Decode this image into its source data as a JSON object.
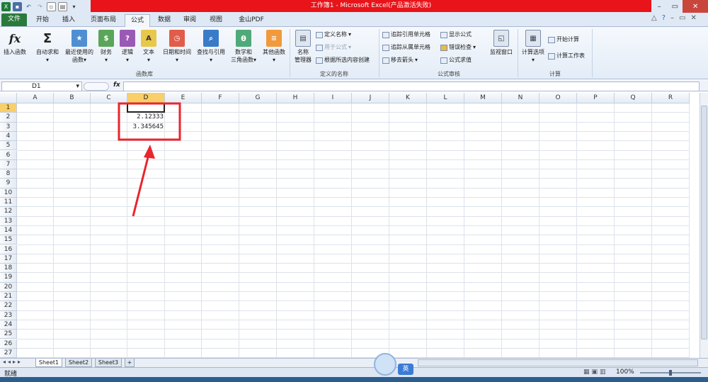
{
  "window": {
    "title": "工作簿1 - Microsoft Excel(产品激活失败)"
  },
  "tabs": [
    "文件",
    "开始",
    "插入",
    "页面布局",
    "公式",
    "数据",
    "审阅",
    "视图",
    "金山PDF"
  ],
  "ribbon": {
    "function_library": {
      "insert_function": "插入函数",
      "autosum": "自动求和",
      "recent_1": "最近使用的",
      "recent_2": "函数",
      "financial": "财务",
      "logical": "逻辑",
      "text": "文本",
      "datetime": "日期和时间",
      "lookup": "查找与引用",
      "math_1": "数学和",
      "math_2": "三角函数",
      "more": "其他函数",
      "group_label": "函数库"
    },
    "defined_names": {
      "name_manager_1": "名称",
      "name_manager_2": "管理器",
      "define_name": "定义名称",
      "use_in_formula": "用于公式",
      "create_from_selection": "根据所选内容创建",
      "group_label": "定义的名称"
    },
    "formula_auditing": {
      "trace_precedents": "追踪引用单元格",
      "trace_dependents": "追踪从属单元格",
      "remove_arrows": "移去箭头",
      "show_formulas": "显示公式",
      "error_checking": "错误检查",
      "evaluate_formula": "公式求值",
      "watch_window": "监视窗口",
      "group_label": "公式审核"
    },
    "calculation": {
      "options": "计算选项",
      "calc_now": "开始计算",
      "calc_sheet": "计算工作表",
      "group_label": "计算"
    }
  },
  "formula_bar": {
    "name_box": "D1",
    "fx": "fx",
    "value": ""
  },
  "grid": {
    "columns": [
      "A",
      "B",
      "C",
      "D",
      "E",
      "F",
      "G",
      "H",
      "I",
      "J",
      "K",
      "L",
      "M",
      "N",
      "O",
      "P",
      "Q",
      "R"
    ],
    "rows": [
      "1",
      "2",
      "3",
      "4",
      "5",
      "6",
      "7",
      "8",
      "9",
      "10",
      "11",
      "12",
      "13",
      "14",
      "15",
      "16",
      "17",
      "18",
      "19",
      "20",
      "21",
      "22",
      "23",
      "24",
      "25",
      "26",
      "27"
    ],
    "selected_cell": "D1",
    "cells": {
      "D2": "2.12333",
      "D3": "3.345645"
    }
  },
  "sheets": [
    "Sheet1",
    "Sheet2",
    "Sheet3"
  ],
  "status": {
    "ready": "就绪",
    "zoom": "100%",
    "ime": "英"
  },
  "colors": {
    "title_highlight": "#e8141a",
    "annotation": "#e8262d",
    "file_tab": "#2a7a3b",
    "selected_header": "#f8cf68"
  }
}
